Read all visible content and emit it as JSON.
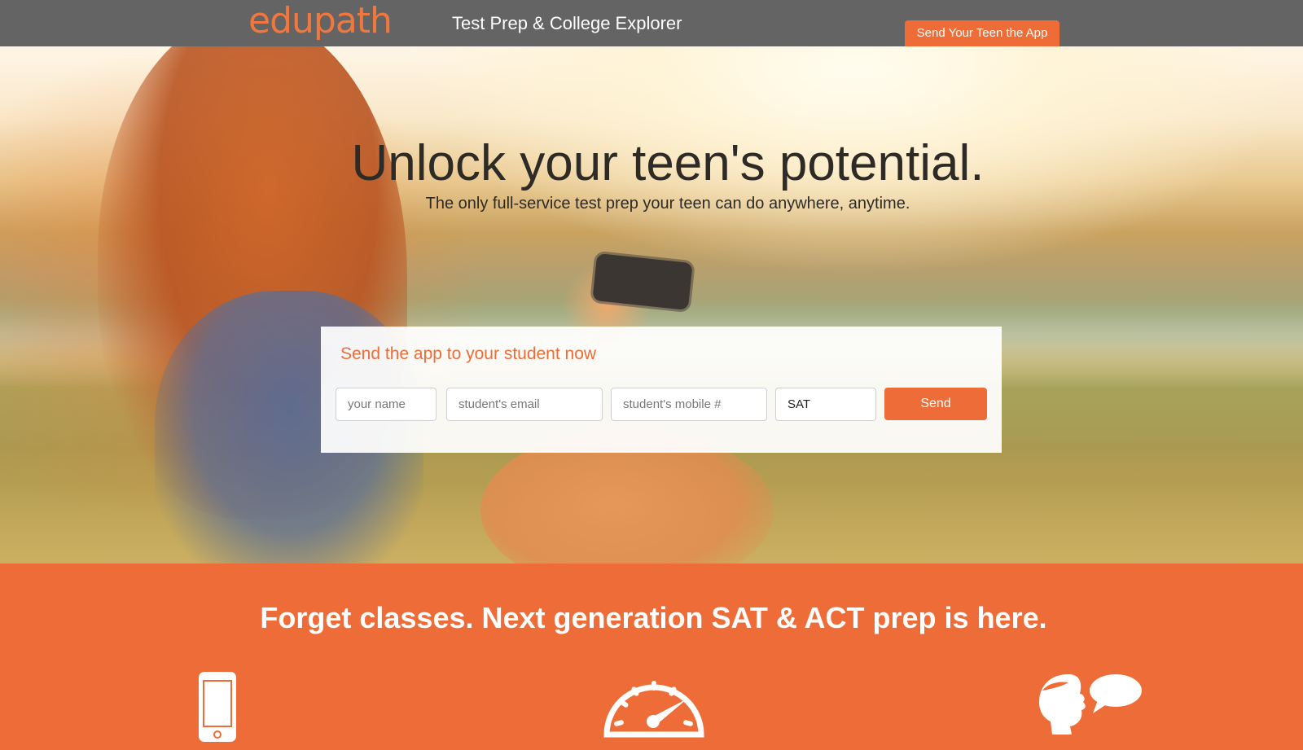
{
  "header": {
    "logo_text": "edupath",
    "tagline": "Test Prep & College Explorer",
    "cta_label": "Send Your Teen the App"
  },
  "hero": {
    "headline": "Unlock your teen's potential.",
    "subheadline": "The only full-service test prep your teen can do anywhere, anytime."
  },
  "signup_form": {
    "title": "Send the app to your student now",
    "name_placeholder": "your name",
    "email_placeholder": "student's email",
    "mobile_placeholder": "student's mobile #",
    "test_value": "SAT",
    "send_label": "Send"
  },
  "features": {
    "title": "Forget classes. Next generation SAT & ACT prep is here.",
    "icons": [
      "smartphone-icon",
      "speedometer-icon",
      "tutor-chat-icon"
    ]
  },
  "colors": {
    "brand_orange": "#ee6c37",
    "header_gray": "#646464",
    "headline_dark": "#2e2a26"
  }
}
